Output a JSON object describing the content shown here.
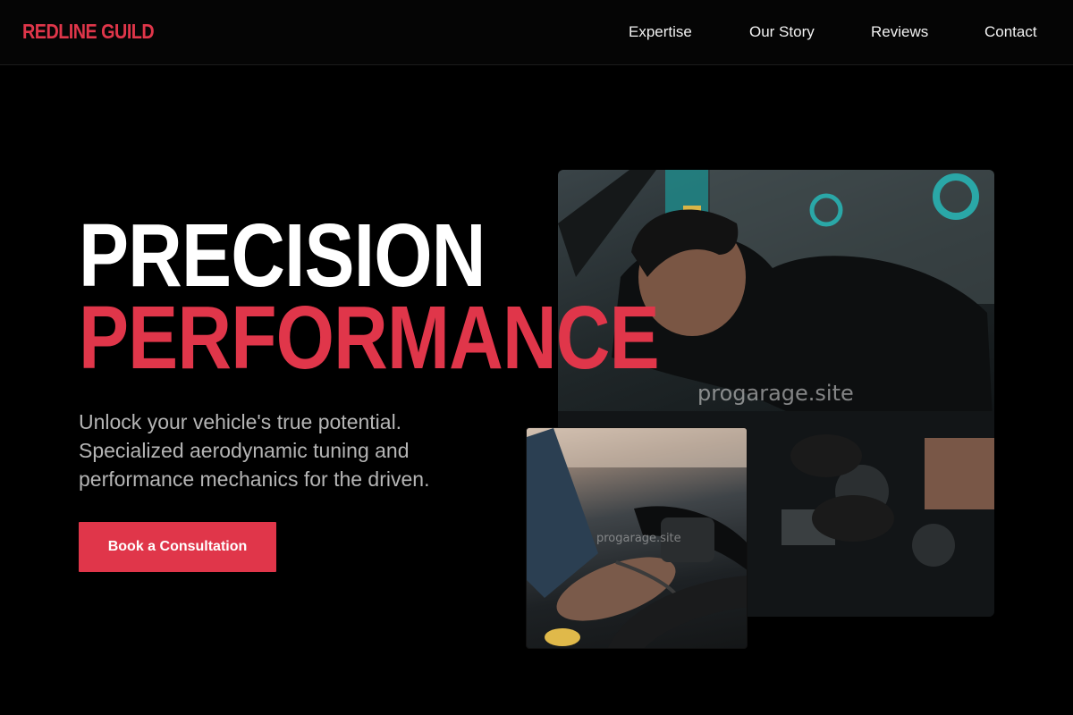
{
  "brand": {
    "logo_text": "REDLINE GUILD",
    "accent_color": "#e0364a"
  },
  "nav": {
    "links": [
      {
        "label": "Expertise"
      },
      {
        "label": "Our Story"
      },
      {
        "label": "Reviews"
      },
      {
        "label": "Contact"
      }
    ]
  },
  "hero": {
    "headline_line1": "PRECISION",
    "headline_line2": "PERFORMANCE",
    "subtitle": "Unlock your vehicle's true potential. Specialized aerodynamic tuning and performance mechanics for the driven.",
    "cta_label": "Book a Consultation"
  },
  "images": {
    "main_watermark": "progarage.site",
    "small_watermark": "progarage.site"
  }
}
